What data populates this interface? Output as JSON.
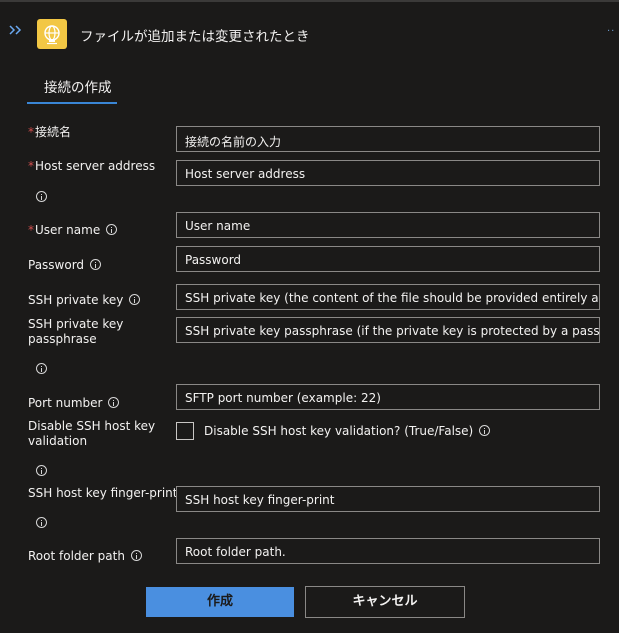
{
  "header": {
    "title": "ファイルが追加または変更されたとき",
    "more": "··"
  },
  "tabs": [
    {
      "label": "接続の作成",
      "active": true
    }
  ],
  "form": {
    "required_mark": "*",
    "connection_name": {
      "label": "接続名",
      "placeholder": "接続の名前の入力"
    },
    "host_server": {
      "label": "Host server address",
      "placeholder": "Host server address"
    },
    "user_name": {
      "label": "User name",
      "placeholder": "User name"
    },
    "password": {
      "label": "Password",
      "placeholder": "Password"
    },
    "ssh_private_key": {
      "label": "SSH private key",
      "placeholder": "SSH private key (the content of the file should be provided entirely as is, in"
    },
    "ssh_passphrase": {
      "label_line1": "SSH private key",
      "label_line2": "passphrase",
      "placeholder": "SSH private key passphrase (if the private key is protected by a passphrase)"
    },
    "port_number": {
      "label": "Port number",
      "placeholder": "SFTP port number (example: 22)"
    },
    "disable_ssh_validation": {
      "label_line1": "Disable SSH host key",
      "label_line2": "validation",
      "checkbox_label": "Disable SSH host key validation? (True/False)",
      "checked": false
    },
    "ssh_fingerprint": {
      "label": "SSH host key finger-print",
      "placeholder": "SSH host key finger-print"
    },
    "root_folder": {
      "label": "Root folder path",
      "placeholder": "Root folder path."
    }
  },
  "buttons": {
    "create": "作成",
    "cancel": "キャンセル"
  },
  "colors": {
    "background": "#1b1a19",
    "accent": "#4a8fe0",
    "required": "#d04e4e",
    "icon_bg": "#f2c744"
  }
}
